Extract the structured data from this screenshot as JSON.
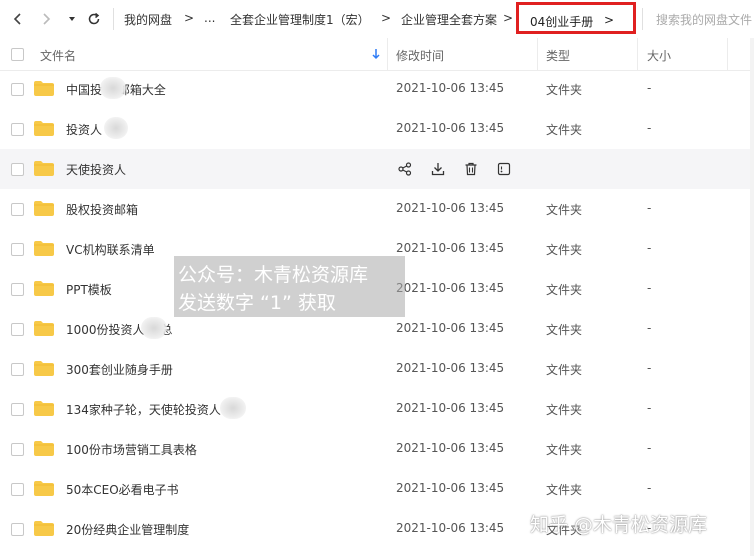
{
  "nav": {
    "breadcrumbs": [
      "我的网盘",
      "...",
      "全套企业管理制度1（宏）",
      "企业管理全套方案"
    ],
    "separator": ">",
    "current": "04创业手册",
    "current_arrow": ">",
    "search_placeholder": "搜索我的网盘文件"
  },
  "columns": {
    "name": "文件名",
    "modified": "修改时间",
    "type": "类型",
    "size": "大小"
  },
  "files": [
    {
      "name": "中国投     人邮箱大全",
      "modified": "2021-10-06 13:45",
      "type": "文件夹",
      "size": "-"
    },
    {
      "name": "投资人",
      "modified": "2021-10-06 13:45",
      "type": "文件夹",
      "size": "-"
    },
    {
      "name": "天使投资人",
      "modified": "",
      "type": "",
      "size": ""
    },
    {
      "name": "股权投资邮箱",
      "modified": "2021-10-06 13:45",
      "type": "文件夹",
      "size": "-"
    },
    {
      "name": "VC机构联系清单",
      "modified": "2021-10-06 13:45",
      "type": "文件夹",
      "size": "-"
    },
    {
      "name": "PPT模板",
      "modified": "2021-10-06 13:45",
      "type": "文件夹",
      "size": "-"
    },
    {
      "name": "1000份投资人       汇总",
      "modified": "2021-10-06 13:45",
      "type": "文件夹",
      "size": "-"
    },
    {
      "name": "300套创业随身手册",
      "modified": "2021-10-06 13:45",
      "type": "文件夹",
      "size": "-"
    },
    {
      "name": "134家种子轮，天使轮投资人",
      "modified": "2021-10-06 13:45",
      "type": "文件夹",
      "size": "-"
    },
    {
      "name": "100份市场营销工具表格",
      "modified": "2021-10-06 13:45",
      "type": "文件夹",
      "size": "-"
    },
    {
      "name": "50本CEO必看电子书",
      "modified": "2021-10-06 13:45",
      "type": "文件夹",
      "size": "-"
    },
    {
      "name": "20份经典企业管理制度",
      "modified": "2021-10-06 13:45",
      "type": "文件夹",
      "size": "-"
    }
  ],
  "overlay": {
    "line1": "公众号：木青松资源库",
    "line2": "发送数字 “1” 获取"
  },
  "watermark": "知乎 @木青松资源库",
  "colors": {
    "folder": "#f7c948",
    "sort_arrow": "#2f7cf6",
    "highlight_border": "#e02020"
  },
  "icons": {
    "back": "chevron-left-icon",
    "forward": "chevron-right-icon",
    "dropdown": "caret-down-icon",
    "refresh": "refresh-icon",
    "share": "share-icon",
    "download": "download-icon",
    "delete": "trash-icon",
    "more": "more-icon"
  }
}
